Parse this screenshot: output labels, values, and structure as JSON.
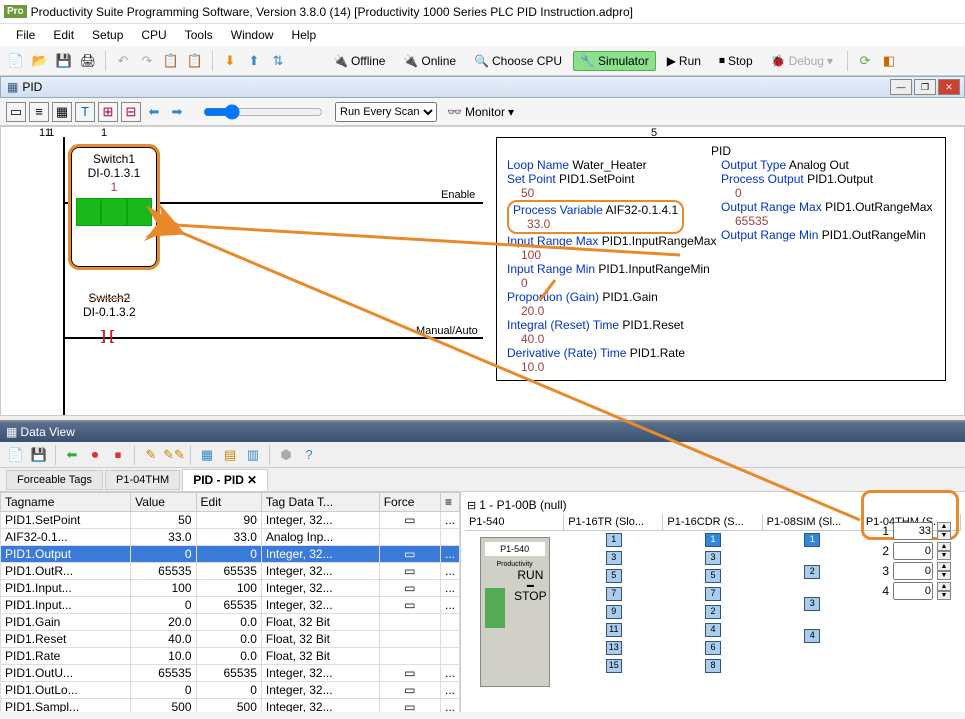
{
  "window": {
    "logo": "Pro",
    "title": "Productivity Suite Programming Software, Version 3.8.0 (14)   [Productivity 1000 Series PLC PID Instruction.adpro]"
  },
  "menu": [
    "File",
    "Edit",
    "Setup",
    "CPU",
    "Tools",
    "Window",
    "Help"
  ],
  "toolbar": {
    "offline": "Offline",
    "online": "Online",
    "choosecpu": "Choose CPU",
    "simulator": "Simulator",
    "run": "Run",
    "stop": "Stop",
    "debug": "Debug"
  },
  "pidwin": {
    "title": "PID"
  },
  "ladder": {
    "runmode": "Run Every Scan",
    "monitor": "Monitor",
    "rung1": "1",
    "rung11": "1.1",
    "col1": "1",
    "col5": "5",
    "switch1": {
      "name": "Switch1",
      "addr": "DI-0.1.3.1",
      "val": "1"
    },
    "switch2": {
      "name": "Switch2",
      "addr": "DI-0.1.3.2"
    },
    "enable": "Enable",
    "manual": "Manual/Auto"
  },
  "pid": {
    "title": "PID",
    "loopname_l": "Loop Name",
    "loopname_v": "Water_Heater",
    "setpoint_l": "Set Point",
    "setpoint_v": "PID1.SetPoint",
    "setpoint_s": "50",
    "pv_l": "Process Variable",
    "pv_v": "AIF32-0.1.4.1",
    "pv_s": "33.0",
    "irmax_l": "Input Range Max",
    "irmax_v": "PID1.InputRangeMax",
    "irmax_s": "100",
    "irmin_l": "Input Range Min",
    "irmin_v": "PID1.InputRangeMin",
    "irmin_s": "0",
    "gain_l": "Proportion (Gain)",
    "gain_v": "PID1.Gain",
    "gain_s": "20.0",
    "reset_l": "Integral (Reset) Time",
    "reset_v": "PID1.Reset",
    "reset_s": "40.0",
    "rate_l": "Derivative (Rate) Time",
    "rate_v": "PID1.Rate",
    "rate_s": "10.0",
    "otype_l": "Output Type",
    "otype_v": "Analog Out",
    "pout_l": "Process Output",
    "pout_v": "PID1.Output",
    "pout_s": "0",
    "ormax_l": "Output Range Max",
    "ormax_v": "PID1.OutRangeMax",
    "ormax_s": "65535",
    "ormin_l": "Output Range Min",
    "ormin_v": "PID1.OutRangeMin"
  },
  "dataview": {
    "title": "Data View",
    "tabs": [
      "Forceable Tags",
      "P1-04THM",
      "PID - PID"
    ],
    "active_tab": 2,
    "cols": [
      "Tagname",
      "Value",
      "Edit",
      "Tag Data T...",
      "Force"
    ],
    "rows": [
      {
        "n": "PID1.SetPoint",
        "v": "50",
        "e": "90",
        "t": "Integer, 32...",
        "f": "...",
        "sel": false
      },
      {
        "n": "AIF32-0.1...",
        "v": "33.0",
        "e": "33.0",
        "t": "Analog Inp...",
        "f": "",
        "sel": false
      },
      {
        "n": "PID1.Output",
        "v": "0",
        "e": "0",
        "t": "Integer, 32...",
        "f": "...",
        "sel": true
      },
      {
        "n": "PID1.OutR...",
        "v": "65535",
        "e": "65535",
        "t": "Integer, 32...",
        "f": "...",
        "sel": false
      },
      {
        "n": "PID1.Input...",
        "v": "100",
        "e": "100",
        "t": "Integer, 32...",
        "f": "...",
        "sel": false
      },
      {
        "n": "PID1.Input...",
        "v": "0",
        "e": "65535",
        "t": "Integer, 32...",
        "f": "...",
        "sel": false
      },
      {
        "n": "PID1.Gain",
        "v": "20.0",
        "e": "0.0",
        "t": "Float, 32 Bit",
        "f": "",
        "sel": false
      },
      {
        "n": "PID1.Reset",
        "v": "40.0",
        "e": "0.0",
        "t": "Float, 32 Bit",
        "f": "",
        "sel": false
      },
      {
        "n": "PID1.Rate",
        "v": "10.0",
        "e": "0.0",
        "t": "Float, 32 Bit",
        "f": "",
        "sel": false
      },
      {
        "n": "PID1.OutU...",
        "v": "65535",
        "e": "65535",
        "t": "Integer, 32...",
        "f": "...",
        "sel": false
      },
      {
        "n": "PID1.OutLo...",
        "v": "0",
        "e": "0",
        "t": "Integer, 32...",
        "f": "...",
        "sel": false
      },
      {
        "n": "PID1.Sampl...",
        "v": "500",
        "e": "500",
        "t": "Integer, 32...",
        "f": "...",
        "sel": false
      }
    ]
  },
  "modules": {
    "root": "1 - P1-00B  (null)",
    "headers": [
      "P1-540",
      "P1-16TR  (Slo...",
      "P1-16CDR  (S...",
      "P1-08SIM  (Sl...",
      "P1-04THM  (S..."
    ],
    "thm": [
      {
        "ch": "1",
        "val": "33"
      },
      {
        "ch": "2",
        "val": "0"
      },
      {
        "ch": "3",
        "val": "0"
      },
      {
        "ch": "4",
        "val": "0"
      }
    ],
    "p1540": {
      "name": "P1-540",
      "sub": "Productivity",
      "run": "RUN",
      "stop": "STOP"
    }
  }
}
